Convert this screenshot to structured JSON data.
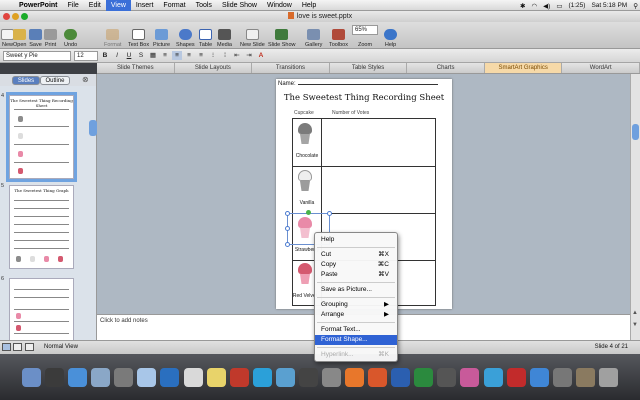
{
  "menubar": {
    "apple": "",
    "items": [
      "PowerPoint",
      "File",
      "Edit",
      "View",
      "Insert",
      "Format",
      "Tools",
      "Slide Show",
      "Window",
      "Help"
    ],
    "active_index": 3,
    "battery": "(1:25)",
    "clock": "Sat 5:18 PM"
  },
  "window": {
    "title": "love is sweet.pptx"
  },
  "toolbar": {
    "new": "New",
    "open": "Open",
    "save": "Save",
    "print": "Print",
    "undo": "Undo",
    "format": "Format",
    "textbox": "Text Box",
    "picture": "Picture",
    "shapes": "Shapes",
    "table": "Table",
    "media": "Media",
    "new_slide": "New Slide",
    "slide_show": "Slide Show",
    "gallery": "Gallery",
    "toolbox": "Toolbox",
    "zoom": "Zoom",
    "help": "Help",
    "zoom_value": "65%"
  },
  "formatting": {
    "font": "Sweet y Pie",
    "size": "12"
  },
  "ribbon": {
    "tabs": [
      "Slide Themes",
      "Slide Layouts",
      "Transitions",
      "Table Styles",
      "Charts",
      "SmartArt Graphics",
      "WordArt"
    ],
    "active_index": 5
  },
  "pane": {
    "tabs": [
      "Slides",
      "Outline"
    ],
    "slides": [
      {
        "number": "4",
        "title": "The Sweetest Thing Recording Sheet"
      },
      {
        "number": "5",
        "title": "The Sweetest Thing Graph"
      },
      {
        "number": "6",
        "title": ""
      }
    ]
  },
  "slide": {
    "name_label": "Name:",
    "title": "The Sweetest Thing Recording Sheet",
    "col_cupcake": "Cupcake",
    "col_votes": "Number of Votes",
    "rows": [
      "Chocolate",
      "Vanilla",
      "Strawberry",
      "Red Velvet"
    ]
  },
  "notes": {
    "placeholder": "Click to add notes"
  },
  "status": {
    "view": "Normal View",
    "slide_count": "Slide 4 of 21"
  },
  "context_menu": {
    "help": "Help",
    "cut": "Cut",
    "cut_sc": "⌘X",
    "copy": "Copy",
    "copy_sc": "⌘C",
    "paste": "Paste",
    "paste_sc": "⌘V",
    "save_as_picture": "Save as Picture...",
    "grouping": "Grouping",
    "arrange": "Arrange",
    "format_text": "Format Text...",
    "format_shape": "Format Shape...",
    "hyperlink": "Hyperlink...",
    "hyperlink_sc": "⌘K"
  },
  "colors": {
    "accent": "#2f62d4",
    "cupcake_pink": "#e98aa8",
    "cupcake_gray": "#8c8c8c",
    "ribbon_active": "#f6d9a8"
  },
  "dock_icons": [
    "finder-icon",
    "dashboard-icon",
    "app-store-icon",
    "mail-icon",
    "photo-icon",
    "preview-icon",
    "itunes-icon",
    "calendar-icon",
    "stickies-icon",
    "flash-icon",
    "skype-icon",
    "sync-icon",
    "dvd-icon",
    "system-preferences-icon",
    "firefox-icon",
    "powerpoint-icon",
    "word-icon",
    "excel-icon",
    "camera-icon",
    "paint-icon",
    "tweet-icon",
    "pdf-icon",
    "chrome-icon",
    "script-icon",
    "downloads-icon",
    "trash-icon"
  ]
}
